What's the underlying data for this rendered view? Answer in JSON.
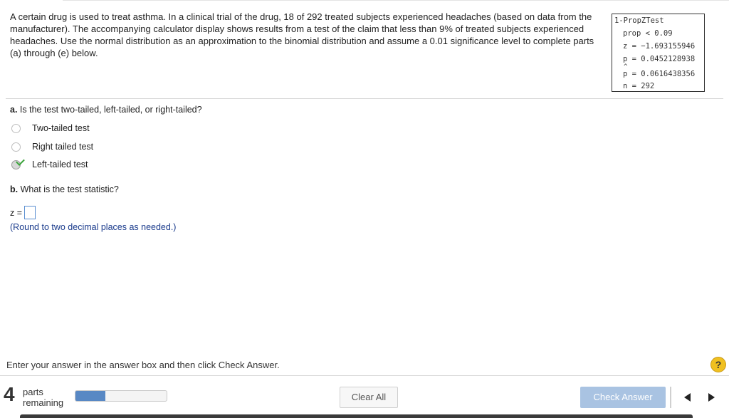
{
  "question": {
    "text": "A certain drug is used to treat asthma. In a clinical trial of the drug, 18 of 292 treated subjects experienced headaches (based on data from the manufacturer). The accompanying calculator display shows results from a test of the claim that less than 9% of treated subjects experienced headaches. Use the normal distribution as an approximation to the binomial distribution and assume a 0.01 significance level to complete parts (a) through (e) below."
  },
  "calculator": {
    "title": "1-PropZTest",
    "prop": "prop < 0.09",
    "z": "z = −1.693155946",
    "p": "p = 0.0452128938",
    "phat_symbol": "p",
    "phat_value": " = 0.0616438356",
    "n": "n = 292"
  },
  "part_a": {
    "label": "a.",
    "question": " Is the test two-tailed, left-tailed, or right-tailed?",
    "options": [
      {
        "label": "Two-tailed test",
        "selected": false
      },
      {
        "label": "Right tailed test",
        "selected": false
      },
      {
        "label": "Left-tailed test",
        "selected": true
      }
    ]
  },
  "part_b": {
    "label": "b.",
    "question": " What is the test statistic?",
    "z_label": "z =",
    "answer_value": "",
    "hint": "(Round to two decimal places as needed.)"
  },
  "footer": {
    "instruction": "Enter your answer in the answer box and then click Check Answer.",
    "help_symbol": "?",
    "parts_count": "4",
    "parts_label_1": "parts",
    "parts_label_2": "remaining",
    "progress_fraction": 0.33,
    "clear_all_label": "Clear All",
    "check_answer_label": "Check Answer"
  },
  "colors": {
    "progress": "#5888c4",
    "check_button": "#a9c3e2",
    "hint_text": "#1a3b8c",
    "help_icon": "#f0c020",
    "checkmark": "#3aa43a"
  }
}
